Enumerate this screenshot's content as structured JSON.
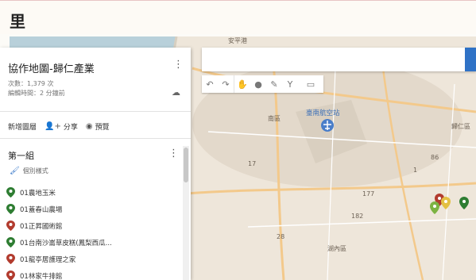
{
  "page": {
    "title": "里"
  },
  "map": {
    "labels": {
      "a_shan": "安平港",
      "nanqu": "南區",
      "airport": "臺南航空站",
      "guiren": "歸仁區",
      "hunei": "湖內區",
      "rd_177": "177",
      "rd_17": "17",
      "rd_86": "86",
      "rd_1": "1",
      "rd_182": "182",
      "rd_28": "28"
    },
    "colors": {
      "water": "#b8d0da",
      "land": "#eee6da",
      "urban": "#e3d9cb",
      "road_major": "#f3c98b",
      "road_minor": "#ffffff",
      "airport_area": "#d9cfc0"
    },
    "markers": [
      {
        "name": "red",
        "color": "#b23b2e"
      },
      {
        "name": "yellow",
        "color": "#e3c043"
      },
      {
        "name": "olive",
        "color": "#6d8b2f"
      },
      {
        "name": "green",
        "color": "#2e7d32"
      },
      {
        "name": "lightgreen",
        "color": "#7cb342"
      }
    ]
  },
  "toolbar": {
    "undo_icon": "undo-icon",
    "redo_icon": "redo-icon",
    "hand_icon": "hand-icon",
    "marker_icon": "marker-icon",
    "line_icon": "draw-line-icon",
    "route_icon": "route-icon",
    "ruler_icon": "ruler-icon"
  },
  "panel": {
    "title": "協作地圖-歸仁產業",
    "views": "次數：1,379 次",
    "edited": "編輯時間：2 分鐘前",
    "actions": {
      "add_layer": "新增圖層",
      "share": "分享",
      "preview": "預覽"
    },
    "layer": {
      "title": "第一組",
      "style": "個別樣式"
    },
    "places": [
      {
        "label": "01農地玉米",
        "color": "#2e7d32"
      },
      {
        "label": "01蓋春山農場",
        "color": "#2e7d32"
      },
      {
        "label": "01正昇國術館",
        "color": "#b23b2e"
      },
      {
        "label": "01台南沙崙草皮糕(鳳梨西瓜...",
        "color": "#2e7d32"
      },
      {
        "label": "01龍亭居護理之家",
        "color": "#b23b2e"
      },
      {
        "label": "01林家牛排館",
        "color": "#b23b2e"
      }
    ]
  }
}
